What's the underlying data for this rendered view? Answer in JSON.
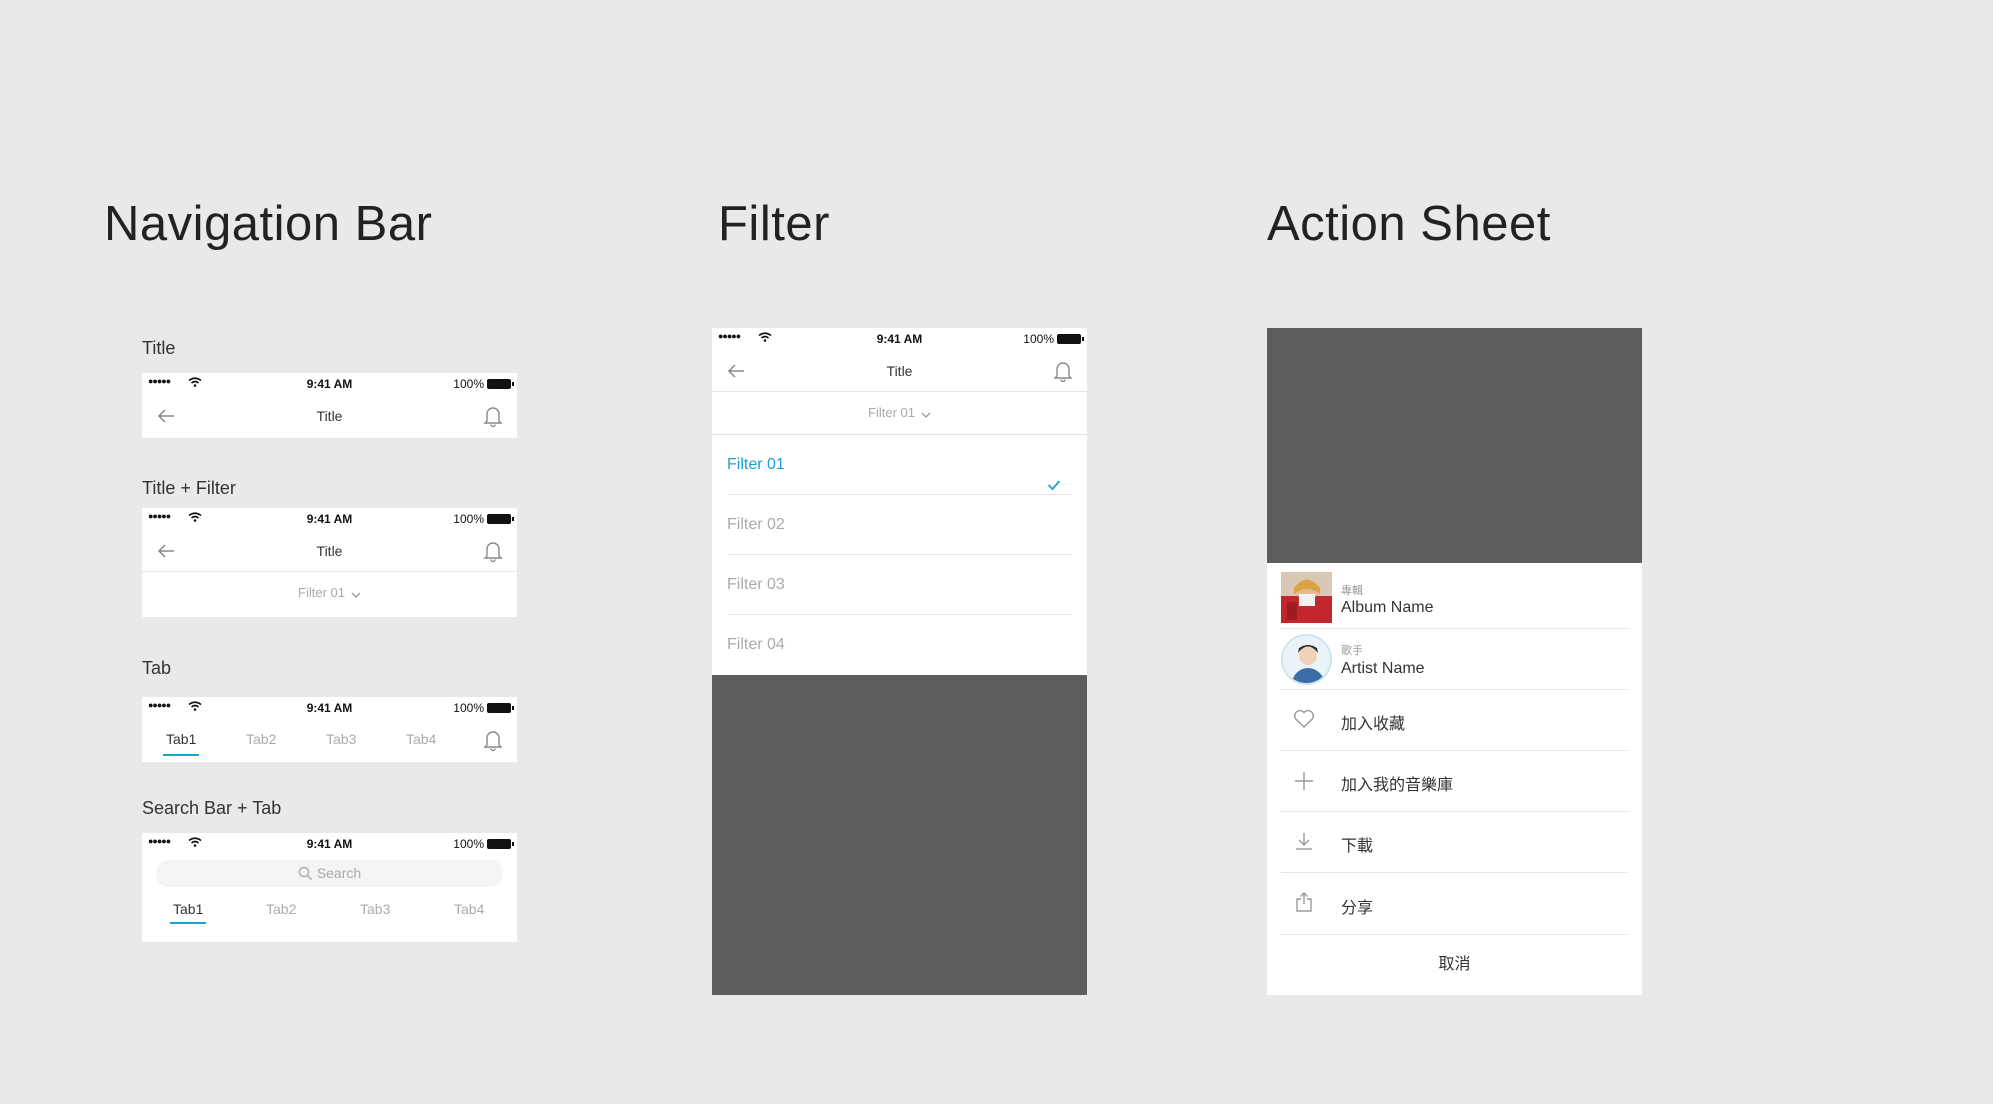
{
  "sections": {
    "navigation_bar": "Navigation Bar",
    "filter": "Filter",
    "action_sheet": "Action Sheet"
  },
  "status_bar": {
    "signal": "●●●●●",
    "time": "9:41 AM",
    "battery": "100%"
  },
  "variants": {
    "title": "Title",
    "title_filter": "Title + Filter",
    "tab": "Tab",
    "search_tab": "Search Bar + Tab"
  },
  "nav": {
    "title": "Title",
    "filter_selected": "Filter 01"
  },
  "tabs": [
    "Tab1",
    "Tab2",
    "Tab3",
    "Tab4"
  ],
  "search": {
    "placeholder": "Search"
  },
  "filter_panel": {
    "title": "Title",
    "current": "Filter 01",
    "options": [
      "Filter 01",
      "Filter 02",
      "Filter 03",
      "Filter 04"
    ],
    "selected_index": 0
  },
  "action_sheet": {
    "album_caption": "專輯",
    "album_name": "Album Name",
    "artist_caption": "歌手",
    "artist_name": "Artist Name",
    "actions": [
      {
        "label": "加入收藏",
        "icon": "heart-icon"
      },
      {
        "label": "加入我的音樂庫",
        "icon": "plus-icon"
      },
      {
        "label": "下載",
        "icon": "download-icon"
      },
      {
        "label": "分享",
        "icon": "share-icon"
      }
    ],
    "cancel": "取消"
  },
  "colors": {
    "background": "#e9e9e9",
    "accent": "#1aa3cc",
    "overlay": "#5d5d5d"
  }
}
